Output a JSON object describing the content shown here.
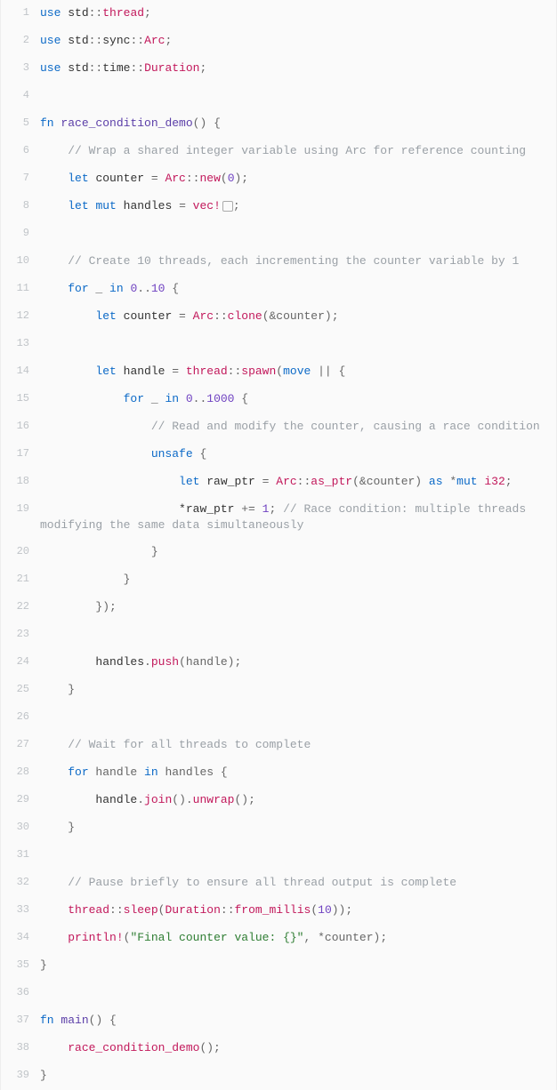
{
  "lines": [
    {
      "n": 1,
      "tokens": [
        [
          "kw",
          "use"
        ],
        [
          "punc",
          " "
        ],
        [
          "path",
          "std"
        ],
        [
          "punc",
          "::"
        ],
        [
          "ty",
          "thread"
        ],
        [
          "punc",
          ";"
        ]
      ]
    },
    {
      "n": 2,
      "tokens": [
        [
          "kw",
          "use"
        ],
        [
          "punc",
          " "
        ],
        [
          "path",
          "std"
        ],
        [
          "punc",
          "::"
        ],
        [
          "path",
          "sync"
        ],
        [
          "punc",
          "::"
        ],
        [
          "ty",
          "Arc"
        ],
        [
          "punc",
          ";"
        ]
      ]
    },
    {
      "n": 3,
      "tokens": [
        [
          "kw",
          "use"
        ],
        [
          "punc",
          " "
        ],
        [
          "path",
          "std"
        ],
        [
          "punc",
          "::"
        ],
        [
          "path",
          "time"
        ],
        [
          "punc",
          "::"
        ],
        [
          "ty",
          "Duration"
        ],
        [
          "punc",
          ";"
        ]
      ]
    },
    {
      "n": 4,
      "tokens": []
    },
    {
      "n": 5,
      "tokens": [
        [
          "kw",
          "fn"
        ],
        [
          "punc",
          " "
        ],
        [
          "fnname",
          "race_condition_demo"
        ],
        [
          "punc",
          "()"
        ],
        [
          "punc",
          " {"
        ]
      ]
    },
    {
      "n": 6,
      "tokens": [
        [
          "punc",
          "    "
        ],
        [
          "cmt",
          "// Wrap a shared integer variable using Arc for reference counting"
        ]
      ]
    },
    {
      "n": 7,
      "tokens": [
        [
          "punc",
          "    "
        ],
        [
          "kw",
          "let"
        ],
        [
          "punc",
          " "
        ],
        [
          "path",
          "counter"
        ],
        [
          "punc",
          " = "
        ],
        [
          "ty",
          "Arc"
        ],
        [
          "punc",
          "::"
        ],
        [
          "fncall",
          "new"
        ],
        [
          "punc",
          "("
        ],
        [
          "num",
          "0"
        ],
        [
          "punc",
          ");"
        ]
      ]
    },
    {
      "n": 8,
      "tokens": [
        [
          "punc",
          "    "
        ],
        [
          "kw",
          "let"
        ],
        [
          "punc",
          " "
        ],
        [
          "kw2",
          "mut"
        ],
        [
          "punc",
          " "
        ],
        [
          "path",
          "handles"
        ],
        [
          "punc",
          " = "
        ],
        [
          "fncall",
          "vec!"
        ],
        [
          "box",
          ""
        ],
        [
          "punc",
          ";"
        ]
      ]
    },
    {
      "n": 9,
      "tokens": []
    },
    {
      "n": 10,
      "tokens": [
        [
          "punc",
          "    "
        ],
        [
          "cmt",
          "// Create 10 threads, each incrementing the counter variable by 1"
        ]
      ]
    },
    {
      "n": 11,
      "tokens": [
        [
          "punc",
          "    "
        ],
        [
          "kw",
          "for"
        ],
        [
          "punc",
          " _ "
        ],
        [
          "kw",
          "in"
        ],
        [
          "punc",
          " "
        ],
        [
          "num",
          "0"
        ],
        [
          "punc",
          ".."
        ],
        [
          "num",
          "10"
        ],
        [
          "punc",
          " {"
        ]
      ]
    },
    {
      "n": 12,
      "tokens": [
        [
          "punc",
          "        "
        ],
        [
          "kw",
          "let"
        ],
        [
          "punc",
          " "
        ],
        [
          "path",
          "counter"
        ],
        [
          "punc",
          " = "
        ],
        [
          "ty",
          "Arc"
        ],
        [
          "punc",
          "::"
        ],
        [
          "fncall",
          "clone"
        ],
        [
          "punc",
          "(&counter);"
        ]
      ]
    },
    {
      "n": 13,
      "tokens": []
    },
    {
      "n": 14,
      "tokens": [
        [
          "punc",
          "        "
        ],
        [
          "kw",
          "let"
        ],
        [
          "punc",
          " "
        ],
        [
          "path",
          "handle"
        ],
        [
          "punc",
          " = "
        ],
        [
          "ty",
          "thread"
        ],
        [
          "punc",
          "::"
        ],
        [
          "fncall",
          "spawn"
        ],
        [
          "punc",
          "("
        ],
        [
          "kw",
          "move"
        ],
        [
          "punc",
          " || {"
        ]
      ]
    },
    {
      "n": 15,
      "tokens": [
        [
          "punc",
          "            "
        ],
        [
          "kw",
          "for"
        ],
        [
          "punc",
          " _ "
        ],
        [
          "kw",
          "in"
        ],
        [
          "punc",
          " "
        ],
        [
          "num",
          "0"
        ],
        [
          "punc",
          ".."
        ],
        [
          "num",
          "1000"
        ],
        [
          "punc",
          " {"
        ]
      ]
    },
    {
      "n": 16,
      "tokens": [
        [
          "punc",
          "                "
        ],
        [
          "cmt",
          "// Read and modify the counter, causing a race condition"
        ]
      ]
    },
    {
      "n": 17,
      "tokens": [
        [
          "punc",
          "                "
        ],
        [
          "kw2",
          "unsafe"
        ],
        [
          "punc",
          " {"
        ]
      ]
    },
    {
      "n": 18,
      "tokens": [
        [
          "punc",
          "                    "
        ],
        [
          "kw",
          "let"
        ],
        [
          "punc",
          " "
        ],
        [
          "path",
          "raw_ptr"
        ],
        [
          "punc",
          " = "
        ],
        [
          "ty",
          "Arc"
        ],
        [
          "punc",
          "::"
        ],
        [
          "fncall",
          "as_ptr"
        ],
        [
          "punc",
          "(&counter) "
        ],
        [
          "kw",
          "as"
        ],
        [
          "punc",
          " *"
        ],
        [
          "kw2",
          "mut"
        ],
        [
          "punc",
          " "
        ],
        [
          "tyword",
          "i32"
        ],
        [
          "punc",
          ";"
        ]
      ]
    },
    {
      "n": 19,
      "tokens": [
        [
          "punc",
          "                    "
        ],
        [
          "op",
          "*"
        ],
        [
          "path",
          "raw_ptr"
        ],
        [
          "punc",
          " += "
        ],
        [
          "num",
          "1"
        ],
        [
          "punc",
          "; "
        ],
        [
          "cmt",
          "// Race condition: multiple threads modifying the same data simultaneously"
        ]
      ]
    },
    {
      "n": 20,
      "tokens": [
        [
          "punc",
          "                }"
        ]
      ]
    },
    {
      "n": 21,
      "tokens": [
        [
          "punc",
          "            }"
        ]
      ]
    },
    {
      "n": 22,
      "tokens": [
        [
          "punc",
          "        });"
        ]
      ]
    },
    {
      "n": 23,
      "tokens": []
    },
    {
      "n": 24,
      "tokens": [
        [
          "punc",
          "        "
        ],
        [
          "path",
          "handles"
        ],
        [
          "punc",
          "."
        ],
        [
          "fncall",
          "push"
        ],
        [
          "punc",
          "(handle);"
        ]
      ]
    },
    {
      "n": 25,
      "tokens": [
        [
          "punc",
          "    }"
        ]
      ]
    },
    {
      "n": 26,
      "tokens": []
    },
    {
      "n": 27,
      "tokens": [
        [
          "punc",
          "    "
        ],
        [
          "cmt",
          "// Wait for all threads to complete"
        ]
      ]
    },
    {
      "n": 28,
      "tokens": [
        [
          "punc",
          "    "
        ],
        [
          "kw",
          "for"
        ],
        [
          "punc",
          " handle "
        ],
        [
          "kw",
          "in"
        ],
        [
          "punc",
          " handles {"
        ]
      ]
    },
    {
      "n": 29,
      "tokens": [
        [
          "punc",
          "        "
        ],
        [
          "path",
          "handle"
        ],
        [
          "punc",
          "."
        ],
        [
          "fncall",
          "join"
        ],
        [
          "punc",
          "()."
        ],
        [
          "fncall",
          "unwrap"
        ],
        [
          "punc",
          "();"
        ]
      ]
    },
    {
      "n": 30,
      "tokens": [
        [
          "punc",
          "    }"
        ]
      ]
    },
    {
      "n": 31,
      "tokens": []
    },
    {
      "n": 32,
      "tokens": [
        [
          "punc",
          "    "
        ],
        [
          "cmt",
          "// Pause briefly to ensure all thread output is complete"
        ]
      ]
    },
    {
      "n": 33,
      "tokens": [
        [
          "punc",
          "    "
        ],
        [
          "ty",
          "thread"
        ],
        [
          "punc",
          "::"
        ],
        [
          "fncall",
          "sleep"
        ],
        [
          "punc",
          "("
        ],
        [
          "ty",
          "Duration"
        ],
        [
          "punc",
          "::"
        ],
        [
          "fncall",
          "from_millis"
        ],
        [
          "punc",
          "("
        ],
        [
          "num",
          "10"
        ],
        [
          "punc",
          "));"
        ]
      ]
    },
    {
      "n": 34,
      "tokens": [
        [
          "punc",
          "    "
        ],
        [
          "fncall",
          "println!"
        ],
        [
          "punc",
          "("
        ],
        [
          "str",
          "\"Final counter value: {}\""
        ],
        [
          "punc",
          ", *counter);"
        ]
      ]
    },
    {
      "n": 35,
      "tokens": [
        [
          "punc",
          "}"
        ]
      ]
    },
    {
      "n": 36,
      "tokens": []
    },
    {
      "n": 37,
      "tokens": [
        [
          "kw",
          "fn"
        ],
        [
          "punc",
          " "
        ],
        [
          "fnname",
          "main"
        ],
        [
          "punc",
          "()"
        ],
        [
          "punc",
          " {"
        ]
      ]
    },
    {
      "n": 38,
      "tokens": [
        [
          "punc",
          "    "
        ],
        [
          "fncall",
          "race_condition_demo"
        ],
        [
          "punc",
          "();"
        ]
      ]
    },
    {
      "n": 39,
      "tokens": [
        [
          "punc",
          "}"
        ]
      ]
    }
  ]
}
